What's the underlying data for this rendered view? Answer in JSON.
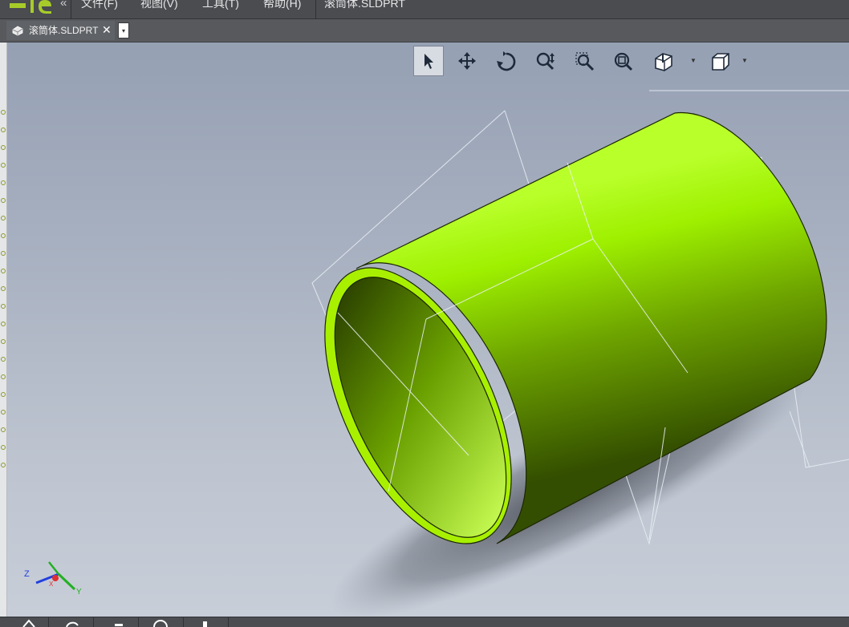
{
  "menubar": {
    "logo": "app-logo",
    "collapse_glyph": "«",
    "menus": [
      {
        "label": "文件(F)"
      },
      {
        "label": "视图(V)"
      },
      {
        "label": "工具(T)"
      },
      {
        "label": "帮助(H)"
      }
    ],
    "document_title": "滚筒体.SLDPRT"
  },
  "tabs": [
    {
      "label": "滚筒体.SLDPRT",
      "icon": "part-icon",
      "close_glyph": "✕",
      "active": true
    }
  ],
  "tab_dropdown_glyph": "▾",
  "view_toolbar": {
    "tools": [
      {
        "name": "select-icon",
        "active": true
      },
      {
        "name": "pan-icon"
      },
      {
        "name": "rotate-icon"
      },
      {
        "name": "zoom-icon"
      },
      {
        "name": "zoom-window-icon"
      },
      {
        "name": "zoom-fit-icon"
      },
      {
        "name": "section-view-icon",
        "has_dropdown": true
      },
      {
        "name": "view-orientation-icon",
        "has_dropdown": true
      }
    ]
  },
  "model": {
    "part_color": "#9be500",
    "shade_color": "#3a5600"
  },
  "triad": {
    "x_label": "X",
    "y_label": "Y",
    "z_label": "Z",
    "colors": {
      "x": "#e03030",
      "y": "#22b022",
      "z": "#2040e0"
    }
  }
}
